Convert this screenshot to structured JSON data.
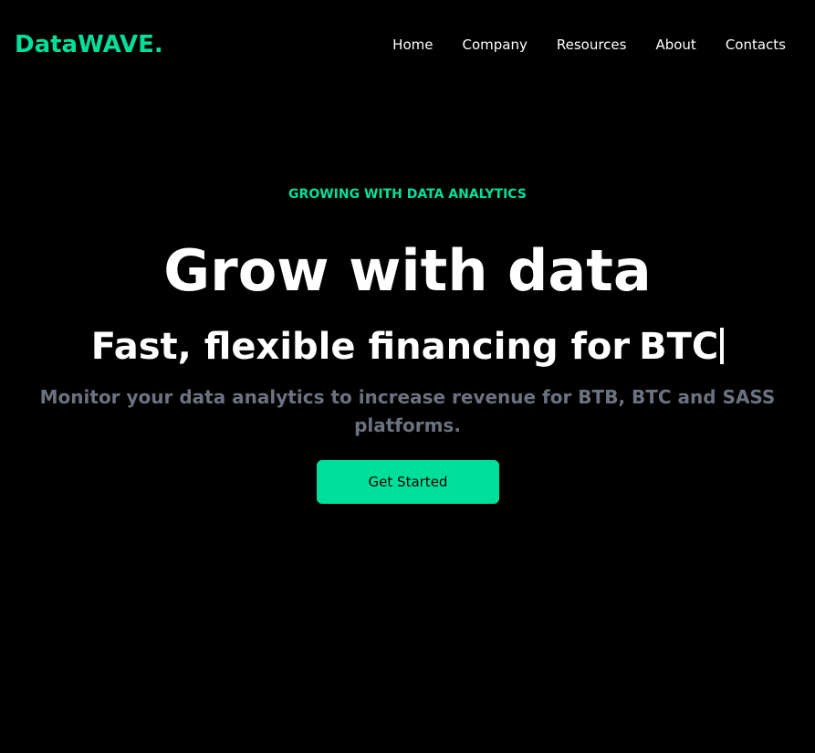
{
  "brand": {
    "logo_text": "DataWAVE.",
    "accent_color": "#00df9a"
  },
  "nav": {
    "items": [
      {
        "label": "Home"
      },
      {
        "label": "Company"
      },
      {
        "label": "Resources"
      },
      {
        "label": "About"
      },
      {
        "label": "Contacts"
      }
    ]
  },
  "hero": {
    "eyebrow": "GROWING WITH DATA ANALYTICS",
    "headline": "Grow with data",
    "subheadline_prefix": "Fast, flexible financing for",
    "typed_word": "BTC",
    "description": "Monitor your data analytics to increase revenue for BTB, BTC and SASS platforms.",
    "cta_label": "Get Started"
  },
  "colors": {
    "background": "#000000",
    "text": "#ffffff",
    "muted_text": "#6b7280"
  }
}
